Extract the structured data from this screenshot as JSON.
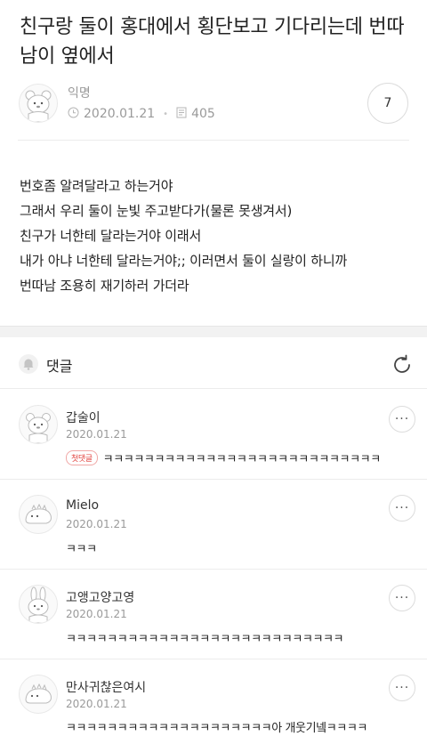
{
  "post": {
    "title": "친구랑 둘이 홍대에서 횡단보고 기다리는데 번따남이 옆에서",
    "author": "익명",
    "date": "2020.01.21",
    "views": "405",
    "comment_count": "7",
    "body_lines": [
      "번호좀 알려달라고 하는거야",
      "그래서 우리 둘이 눈빛 주고받다가(물론 못생겨서)",
      "친구가 너한테 달라는거야 이래서",
      "내가 아냐 너한테 달라는거야;; 이러면서 둘이 실랑이 하니까",
      "번따남 조용히 재기하러 가더라"
    ]
  },
  "icons": {
    "clock": "clock-icon",
    "document": "document-icon",
    "bell": "bell-icon",
    "refresh": "refresh-icon",
    "more": "more-icon"
  },
  "comments_section": {
    "title": "댓글"
  },
  "comments": [
    {
      "name": "갑술이",
      "date": "2020.01.21",
      "badge": "첫댓글",
      "text": "ㅋㅋㅋㅋㅋㅋㅋㅋㅋㅋㅋㅋㅋㅋㅋㅋㅋㅋㅋㅋㅋㅋㅋㅋㅋㅋㅋ",
      "avatar": "bear"
    },
    {
      "name": "Mielo",
      "date": "2020.01.21",
      "text": "ㅋㅋㅋ",
      "avatar": "dino"
    },
    {
      "name": "고앵고양고영",
      "date": "2020.01.21",
      "text": "ㅋㅋㅋㅋㅋㅋㅋㅋㅋㅋㅋㅋㅋㅋㅋㅋㅋㅋㅋㅋㅋㅋㅋㅋㅋㅋㅋ",
      "avatar": "bunny"
    },
    {
      "name": "만사귀찮은여시",
      "date": "2020.01.21",
      "text": "ㅋㅋㅋㅋㅋㅋㅋㅋㅋㅋㅋㅋㅋㅋㅋㅋㅋㅋㅋㅋ아 개웃기넼ㅋㅋㅋㅋ",
      "avatar": "dino"
    }
  ],
  "colors": {
    "muted": "#9a9a9a",
    "badge_red": "#e2433f",
    "divider": "#ececec"
  }
}
